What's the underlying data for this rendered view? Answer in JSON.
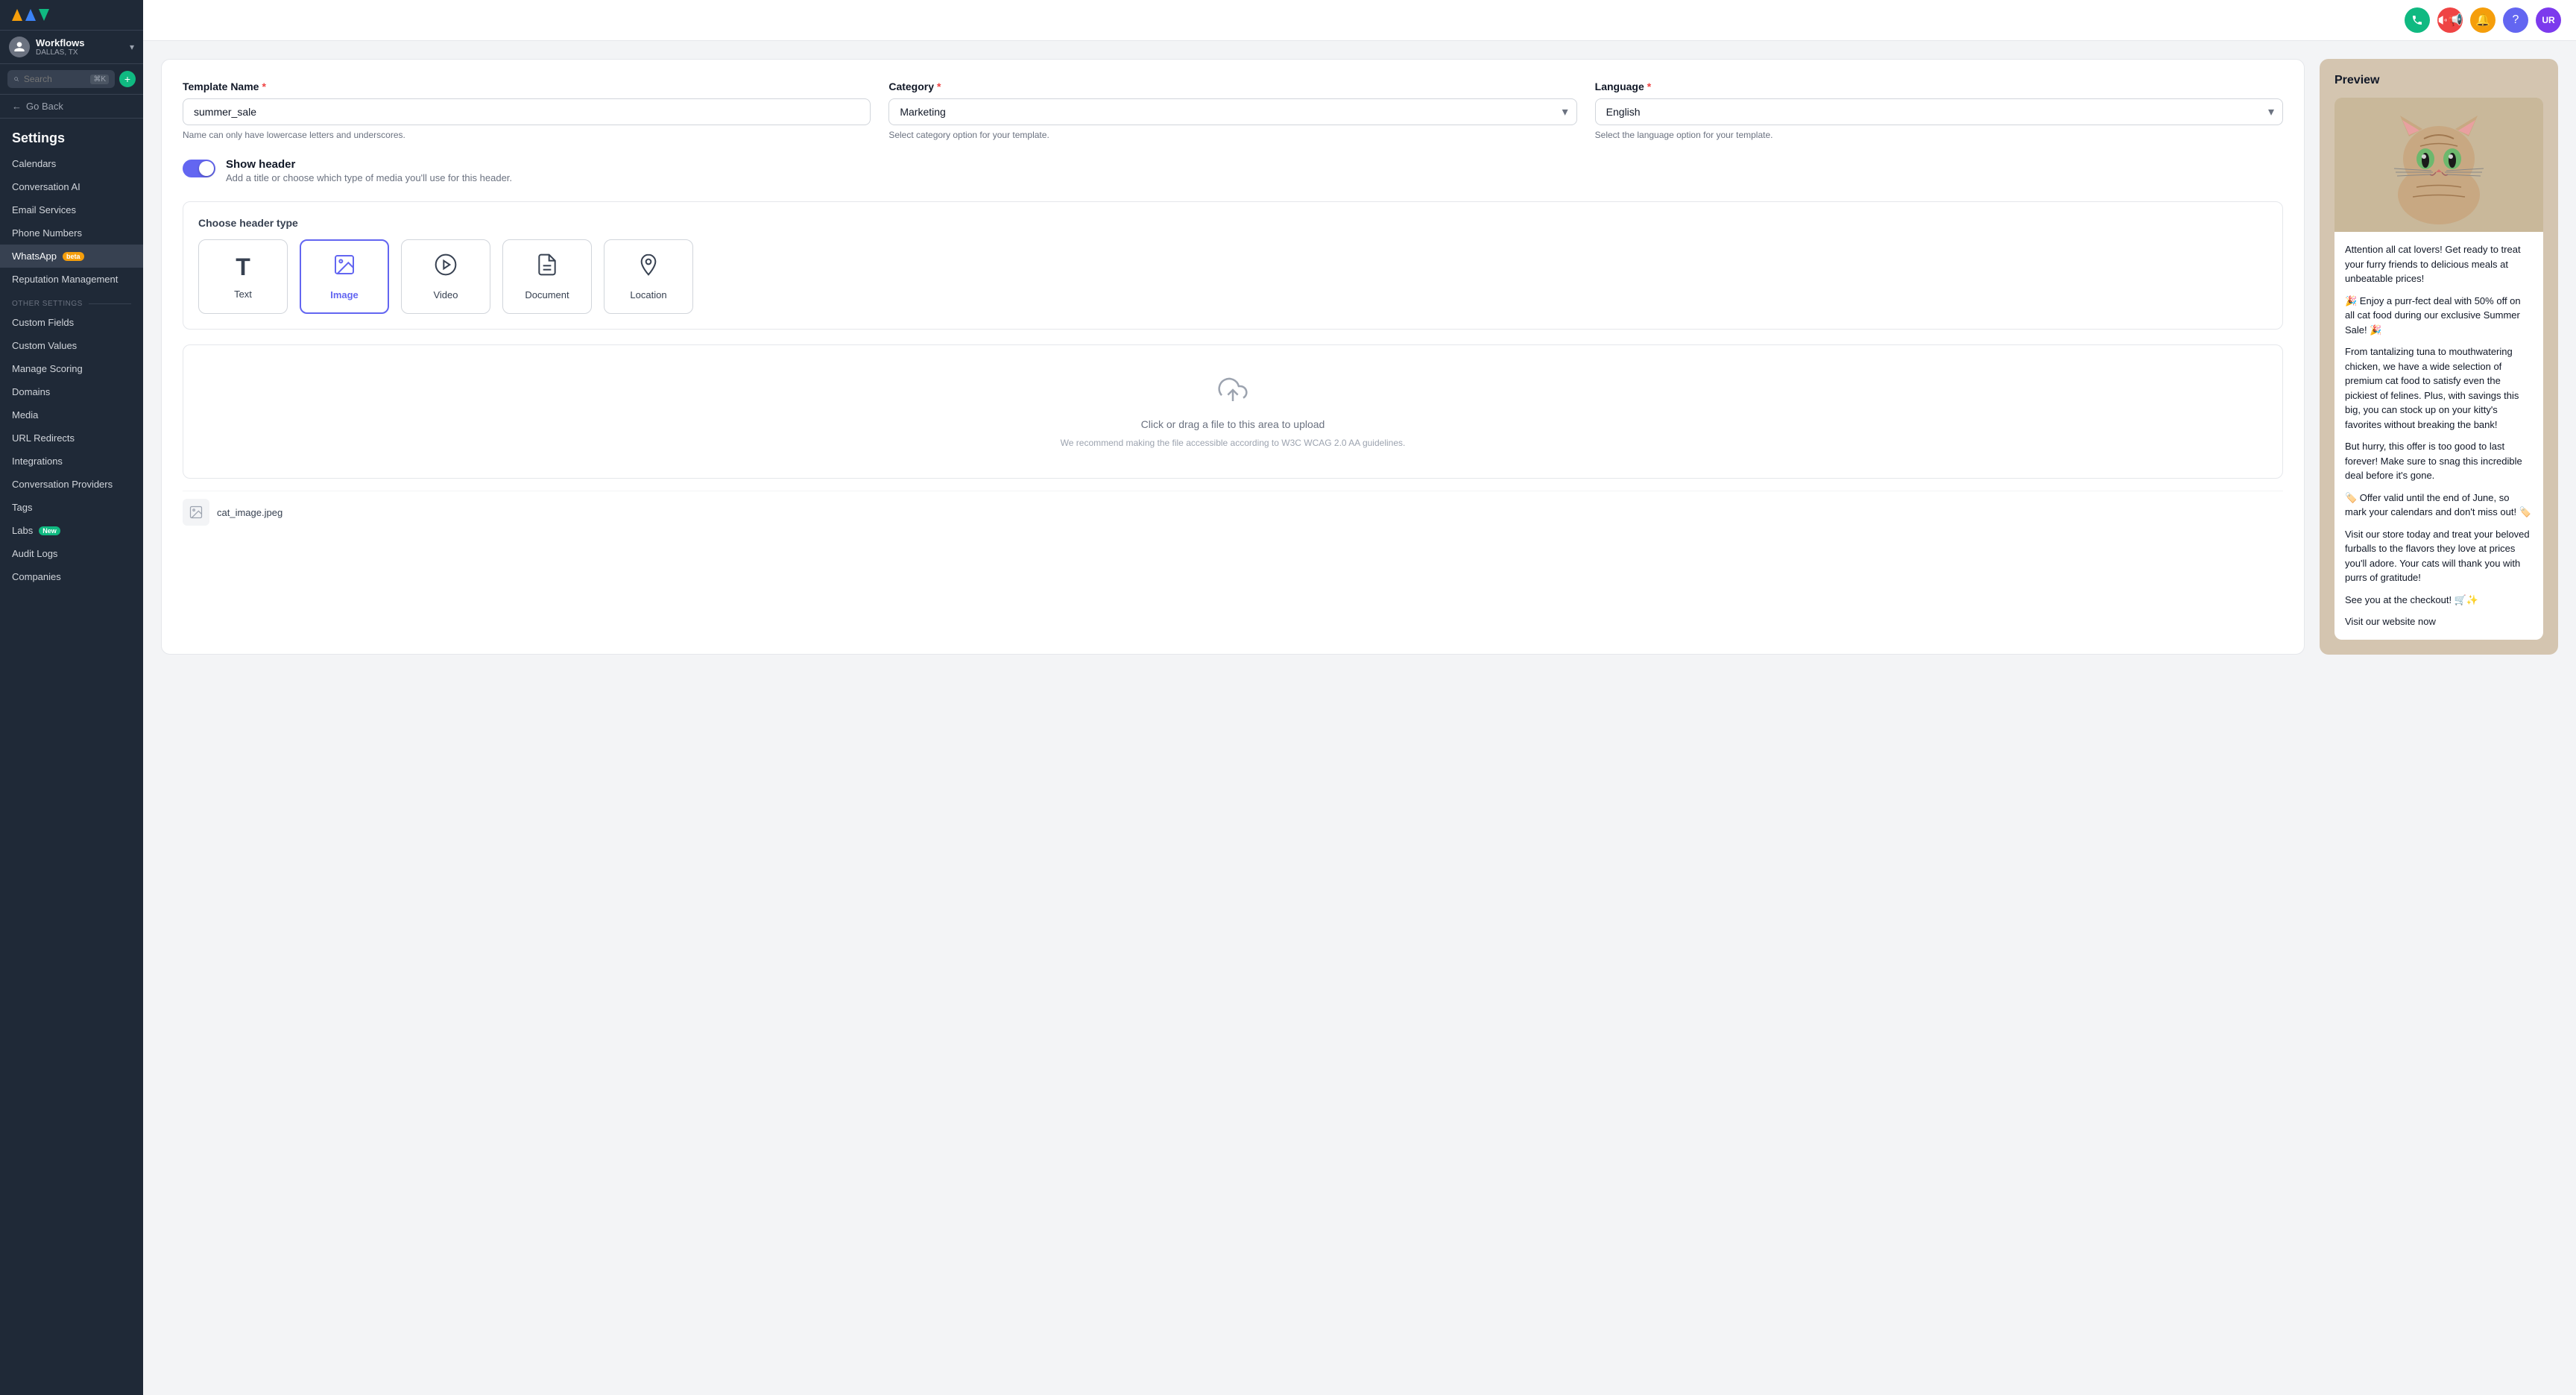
{
  "sidebar": {
    "workspace_name": "Workflows",
    "workspace_location": "DALLAS, TX",
    "search_placeholder": "Search",
    "search_shortcut": "⌘K",
    "go_back_label": "Go Back",
    "settings_label": "Settings",
    "nav_items": [
      {
        "id": "calendars",
        "label": "Calendars",
        "active": false
      },
      {
        "id": "conversation-ai",
        "label": "Conversation AI",
        "active": false
      },
      {
        "id": "email-services",
        "label": "Email Services",
        "active": false
      },
      {
        "id": "phone-numbers",
        "label": "Phone Numbers",
        "active": false
      },
      {
        "id": "whatsapp",
        "label": "WhatsApp",
        "active": true,
        "badge": "beta"
      },
      {
        "id": "reputation-management",
        "label": "Reputation Management",
        "active": false
      }
    ],
    "other_settings_label": "OTHER SETTINGS",
    "other_nav_items": [
      {
        "id": "custom-fields",
        "label": "Custom Fields",
        "active": false
      },
      {
        "id": "custom-values",
        "label": "Custom Values",
        "active": false
      },
      {
        "id": "manage-scoring",
        "label": "Manage Scoring",
        "active": false
      },
      {
        "id": "domains",
        "label": "Domains",
        "active": false
      },
      {
        "id": "media",
        "label": "Media",
        "active": false
      },
      {
        "id": "url-redirects",
        "label": "URL Redirects",
        "active": false
      },
      {
        "id": "integrations",
        "label": "Integrations",
        "active": false
      },
      {
        "id": "conversation-providers",
        "label": "Conversation Providers",
        "active": false
      },
      {
        "id": "tags",
        "label": "Tags",
        "active": false
      },
      {
        "id": "labs",
        "label": "Labs",
        "active": false,
        "badge": "New"
      },
      {
        "id": "audit-logs",
        "label": "Audit Logs",
        "active": false
      },
      {
        "id": "companies",
        "label": "Companies",
        "active": false
      }
    ]
  },
  "topbar": {
    "user_initials": "UR"
  },
  "form": {
    "template_name_label": "Template Name",
    "template_name_value": "summer_sale",
    "template_name_hint": "Name can only have lowercase letters and underscores.",
    "category_label": "Category",
    "category_value": "Marketing",
    "category_hint": "Select category option for your template.",
    "language_label": "Language",
    "language_value": "English",
    "language_hint": "Select the language option for your template.",
    "show_header_label": "Show header",
    "show_header_hint": "Add a title or choose which type of media you'll use for this header.",
    "header_type_label": "Choose header type",
    "header_options": [
      {
        "id": "text",
        "label": "Text",
        "icon": "T",
        "selected": false
      },
      {
        "id": "image",
        "label": "Image",
        "icon": "🖼",
        "selected": true
      },
      {
        "id": "video",
        "label": "Video",
        "icon": "▶",
        "selected": false
      },
      {
        "id": "document",
        "label": "Document",
        "icon": "📄",
        "selected": false
      },
      {
        "id": "location",
        "label": "Location",
        "icon": "📍",
        "selected": false
      }
    ],
    "upload_text": "Click or drag a file to this area to upload",
    "upload_hint": "We recommend making the file accessible according to W3C WCAG 2.0 AA guidelines.",
    "file_name": "cat_image.jpeg"
  },
  "preview": {
    "title": "Preview",
    "text_blocks": [
      "Attention all cat lovers! Get ready to treat your furry friends to delicious meals at unbeatable prices!",
      "🎉 Enjoy a purr-fect deal with 50% off on all cat food during our exclusive Summer Sale! 🎉",
      "From tantalizing tuna to mouthwatering chicken, we have a wide selection of premium cat food to satisfy even the pickiest of felines. Plus, with savings this big, you can stock up on your kitty's favorites without breaking the bank!",
      "But hurry, this offer is too good to last forever! Make sure to snag this incredible deal before it's gone.",
      "🏷️ Offer valid until the end of June, so mark your calendars and don't miss out! 🏷️",
      "Visit our store today and treat your beloved furballs to the flavors they love at prices you'll adore. Your cats will thank you with purrs of gratitude!",
      "See you at the checkout! 🛒✨",
      "Visit our website now"
    ]
  }
}
